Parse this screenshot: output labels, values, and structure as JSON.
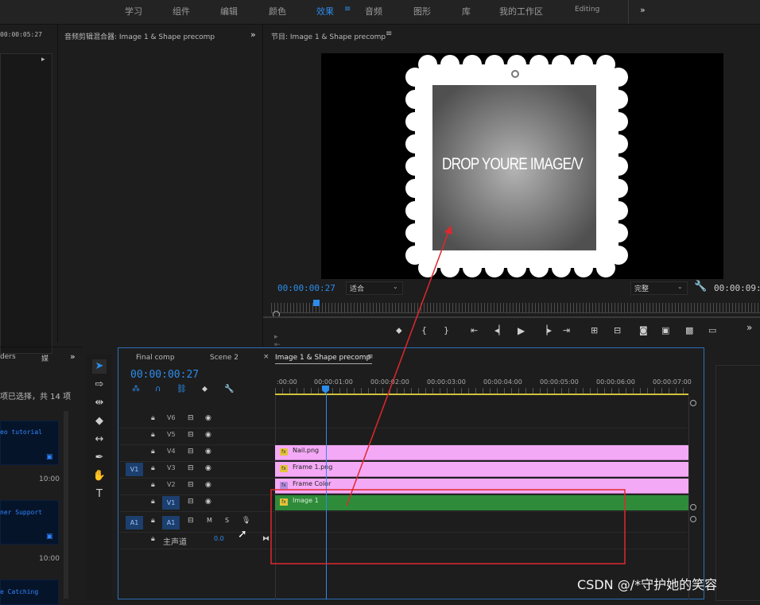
{
  "workspace_tabs": [
    "学习",
    "组件",
    "编辑",
    "颜色",
    "效果",
    "音频",
    "图形",
    "库",
    "我的工作区",
    "Editing"
  ],
  "workspace_active": "效果",
  "workspace_more": "»",
  "source_panel": {
    "timecode": "00:00:05:27",
    "expand": "▸"
  },
  "audio_mixer": {
    "title": "音频剪辑混合器: Image 1 & Shape precomp",
    "more": "»"
  },
  "program": {
    "title": "节目: Image 1 & Shape precomp",
    "menu": "≡",
    "preview_text": "DROP YOURE IMAGE/V",
    "timecode_current": "00:00:00:27",
    "fit_select": "适合",
    "quality_select": "完整",
    "timecode_duration": "00:00:09:2",
    "more": "»"
  },
  "project_panel": {
    "title_left": "ders",
    "title_right": "媒",
    "more": "»",
    "selection_info": "项已选择，共 14 项",
    "items": [
      {
        "label": "eo tutorial",
        "duration": "10:00"
      },
      {
        "label": "ner Support",
        "duration": "10:00"
      },
      {
        "label": "e Catching",
        "duration": ""
      }
    ]
  },
  "timeline": {
    "tabs": [
      "Final comp",
      "Scene 2",
      "Image 1 & Shape precomp"
    ],
    "active_tab": "Image 1 & Shape precomp",
    "close": "×",
    "menu": "≡",
    "timecode": "00:00:00:27",
    "ruler": [
      ":00:00",
      "00:00:01:00",
      "00:00:02:00",
      "00:00:03:00",
      "00:00:04:00",
      "00:00:05:00",
      "00:00:06:00",
      "00:00:07:00"
    ],
    "video_tracks": [
      {
        "name": "V6",
        "clip": ""
      },
      {
        "name": "V5",
        "clip": ""
      },
      {
        "name": "V4",
        "clip": "Nail.png"
      },
      {
        "name": "V3",
        "clip": "Frame 1.png",
        "source": "V1"
      },
      {
        "name": "V2",
        "clip": "Frame Color"
      },
      {
        "name": "V1",
        "clip": "Image 1"
      }
    ],
    "audio_track": {
      "source": "A1",
      "name": "A1",
      "m": "M",
      "s": "S"
    },
    "master": {
      "label": "主声道",
      "value": "0.0"
    }
  },
  "watermark": "CSDN @/*守护她的笑容",
  "colors": {
    "accent": "#2d8ceb",
    "pink_clip": "#f4a9f6",
    "green_clip": "#2e8b3a",
    "annotation": "#e0282e"
  }
}
